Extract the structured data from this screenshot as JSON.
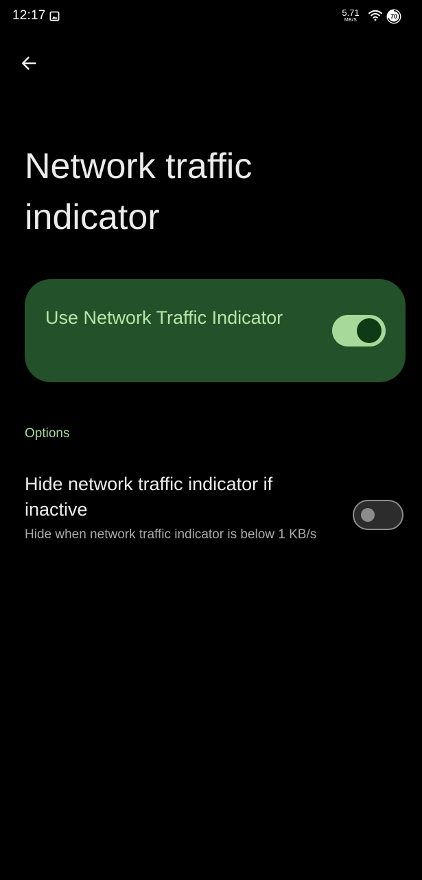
{
  "status_bar": {
    "time": "12:17",
    "network_speed_value": "5.71",
    "network_speed_unit": "MB/S",
    "battery_level": "70",
    "icons": [
      "image-notification-icon",
      "wifi-icon",
      "battery-icon"
    ]
  },
  "header": {
    "back_icon": "arrow-back-icon",
    "title": "Network traffic indicator"
  },
  "main_toggle": {
    "label": "Use Network Traffic Indicator",
    "enabled": true,
    "card_color": "#23512a",
    "label_color": "#b7e6a8"
  },
  "options_section": {
    "header": "Options",
    "items": [
      {
        "title": "Hide network traffic indicator if inactive",
        "summary": "Hide when network traffic indicator is below 1 KB/s",
        "enabled": false
      }
    ]
  },
  "colors": {
    "background": "#000000",
    "accent": "#a7d99a",
    "text_primary": "#ececec",
    "text_secondary": "#a9a9a9"
  }
}
